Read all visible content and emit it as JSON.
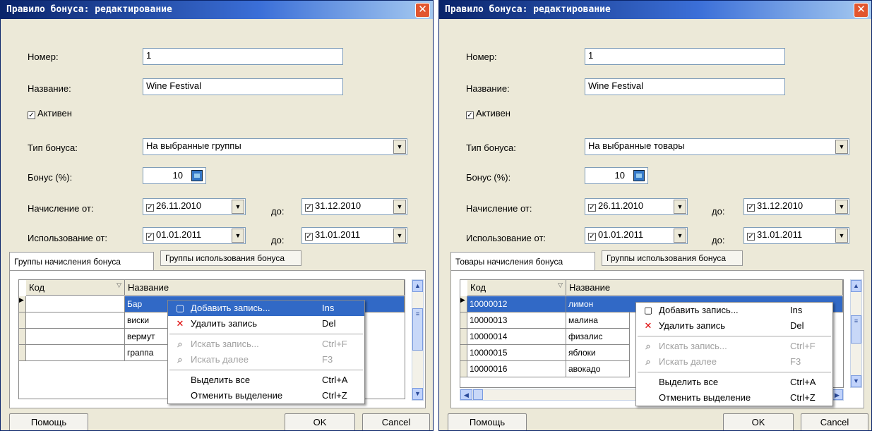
{
  "windows": [
    {
      "title": "Правило бонуса: редактирование",
      "fields": {
        "number_label": "Номер:",
        "number_value": "1",
        "name_label": "Название:",
        "name_value": "Wine Festival",
        "active_label": "Активен",
        "type_label": "Тип бонуса:",
        "type_value": "На выбранные группы",
        "bonus_label": "Бонус (%):",
        "bonus_value": "10",
        "accrual_label": "Начисление от:",
        "accrual_from": "26.11.2010",
        "to_label": "до:",
        "accrual_to": "31.12.2010",
        "usage_label": "Использование от:",
        "usage_from": "01.01.2011",
        "usage_to": "31.01.2011"
      },
      "tabs": [
        "Группы начисления бонуса",
        "Группы использования бонуса"
      ],
      "columns": [
        "Код",
        "Название"
      ],
      "rows": [
        {
          "code": "",
          "name": "Бар"
        },
        {
          "code": "",
          "name": "виски"
        },
        {
          "code": "",
          "name": "вермут"
        },
        {
          "code": "",
          "name": "граппа"
        }
      ]
    },
    {
      "title": "Правило бонуса: редактирование",
      "fields": {
        "number_label": "Номер:",
        "number_value": "1",
        "name_label": "Название:",
        "name_value": "Wine Festival",
        "active_label": "Активен",
        "type_label": "Тип бонуса:",
        "type_value": "На выбранные товары",
        "bonus_label": "Бонус (%):",
        "bonus_value": "10",
        "accrual_label": "Начисление от:",
        "accrual_from": "26.11.2010",
        "to_label": "до:",
        "accrual_to": "31.12.2010",
        "usage_label": "Использование от:",
        "usage_from": "01.01.2011",
        "usage_to": "31.01.2011"
      },
      "tabs": [
        "Товары начисления бонуса",
        "Группы использования бонуса"
      ],
      "columns": [
        "Код",
        "Название"
      ],
      "rows": [
        {
          "code": "10000012",
          "name": "лимон"
        },
        {
          "code": "10000013",
          "name": "малина"
        },
        {
          "code": "10000014",
          "name": "физалис"
        },
        {
          "code": "10000015",
          "name": "яблоки"
        },
        {
          "code": "10000016",
          "name": "авокадо"
        }
      ]
    }
  ],
  "menu": [
    {
      "label": "Добавить запись...",
      "shortcut": "Ins",
      "icon": "new-record-icon",
      "enabled": true
    },
    {
      "label": "Удалить запись",
      "shortcut": "Del",
      "icon": "delete-icon",
      "enabled": true
    },
    {
      "label": "Искать запись...",
      "shortcut": "Ctrl+F",
      "icon": "binoculars-icon",
      "enabled": false
    },
    {
      "label": "Искать далее",
      "shortcut": "F3",
      "icon": "find-next-icon",
      "enabled": false
    },
    {
      "label": "Выделить все",
      "shortcut": "Ctrl+A",
      "icon": "",
      "enabled": true
    },
    {
      "label": "Отменить выделение",
      "shortcut": "Ctrl+Z",
      "icon": "",
      "enabled": true
    }
  ],
  "buttons": {
    "help": "Помощь",
    "ok": "OK",
    "cancel": "Cancel"
  }
}
